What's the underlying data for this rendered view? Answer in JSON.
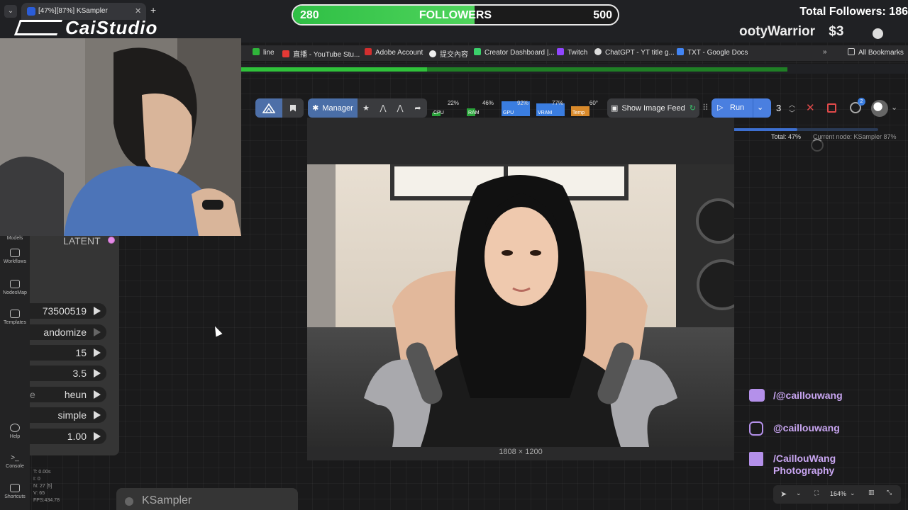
{
  "browser": {
    "tab_title": "[47%][87%] KSampler",
    "new_tab": "+",
    "tab_close": "✕",
    "menu": "⌄"
  },
  "overlay": {
    "followers_current": "280",
    "followers_label": "FOLLOWERS",
    "followers_goal": "500",
    "followers_progress": 0.56,
    "total_followers": "Total Followers: 186",
    "alert_name": "ootyWarrior",
    "alert_amount": "$3",
    "brand": "CaiStudio"
  },
  "bookmarks": [
    {
      "label": "line",
      "color": "#2fb53a"
    },
    {
      "label": "直播 - YouTube Stu...",
      "color": "#e53935"
    },
    {
      "label": "Adobe Account",
      "color": "#d32f2f"
    },
    {
      "label": "提交內容",
      "color": "#eeeeee"
    },
    {
      "label": "Creator Dashboard |...",
      "color": "#3bd16b"
    },
    {
      "label": "Twitch",
      "color": "#9146ff"
    },
    {
      "label": "ChatGPT - YT title g...",
      "color": "#dddddd"
    },
    {
      "label": "TXT - Google Docs",
      "color": "#4285f4"
    }
  ],
  "all_bookmarks": "All Bookmarks",
  "page_load_progress": 0.34,
  "toolbar": {
    "manager_label": "Manager",
    "monitors": [
      {
        "label": "CPU",
        "value": "22%",
        "fill": 0.22,
        "color": "#2aa33a"
      },
      {
        "label": "RAM",
        "value": "46%",
        "fill": 0.46,
        "color": "#2aa33a"
      },
      {
        "label": "GPU",
        "value": "92%",
        "fill": 0.92,
        "color": "#3a7de0"
      },
      {
        "label": "VRAM",
        "value": "77%",
        "fill": 0.77,
        "color": "#3a7de0"
      },
      {
        "label": "Temp",
        "value": "60°",
        "fill": 0.6,
        "color": "#d98a2b"
      }
    ],
    "show_image_feed": "Show Image Feed",
    "run_label": "Run",
    "batch_count": "3",
    "queue_badge": "2"
  },
  "execution": {
    "total_label": "Total: 47%",
    "total_progress": 0.47,
    "current_node": "Current node: KSampler 87%"
  },
  "preview": {
    "dimensions": "1808 × 1200"
  },
  "sidebar": {
    "items": [
      {
        "label": "Models"
      },
      {
        "label": "Workflows"
      },
      {
        "label": "NodesMap"
      },
      {
        "label": "Templates"
      },
      {
        "label": "Help"
      },
      {
        "label": "Console"
      },
      {
        "label": "Shortcuts"
      }
    ],
    "stats": [
      "T: 0.00s",
      "I: 0",
      "N: 27 [5]",
      "V: 65",
      "FPS:434.78"
    ]
  },
  "node": {
    "latent_label": "LATENT",
    "widgets": [
      {
        "label": "",
        "value": "73500519"
      },
      {
        "label": "",
        "value": "andomize"
      },
      {
        "label": "",
        "value": "15"
      },
      {
        "label": "",
        "value": "3.5"
      },
      {
        "label": "e",
        "value": "heun"
      },
      {
        "label": "",
        "value": "simple"
      },
      {
        "label": "",
        "value": "1.00"
      }
    ],
    "second_node_title": "KSampler"
  },
  "social": {
    "youtube": "/@caillouwang",
    "instagram": "@caillouwang",
    "facebook_line1": "/CaillouWang",
    "facebook_line2": "Photography"
  },
  "canvas": {
    "zoom": "164%"
  }
}
